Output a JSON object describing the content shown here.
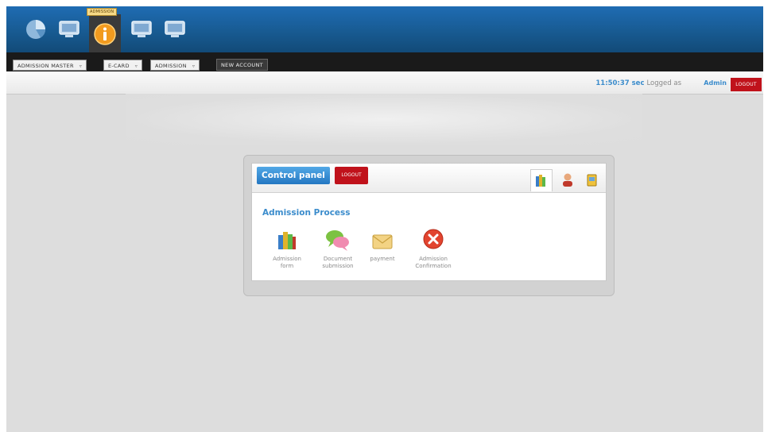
{
  "header": {
    "icons": [
      {
        "name": "pie-chart-icon"
      },
      {
        "name": "monitor-icon"
      },
      {
        "name": "info-icon",
        "tooltip": "ADMISSION"
      },
      {
        "name": "monitor-icon"
      },
      {
        "name": "monitor-icon"
      }
    ]
  },
  "menu": [
    {
      "label": "ADMISSION MASTER"
    },
    {
      "label": "E-CARD"
    },
    {
      "label": "ADMISSION"
    },
    {
      "label": "NEW ACCOUNT"
    }
  ],
  "status": {
    "time": "11:50:37 sec",
    "logged_as": "Logged as",
    "user": "Admin",
    "logout": "LOGOUT"
  },
  "panel": {
    "title": "Control panel",
    "logout": "LOGOUT",
    "section_title": "Admission Process",
    "apps": [
      {
        "line1": "Admission",
        "line2": "form"
      },
      {
        "line1": "Document",
        "line2": "submission"
      },
      {
        "line1": "payment",
        "line2": ""
      },
      {
        "line1": "Admission",
        "line2": "Confirmation"
      }
    ]
  },
  "colors": {
    "brand_blue": "#1f6cb3",
    "accent_blue": "#3b8ccc",
    "logout_red": "#c0121b"
  }
}
